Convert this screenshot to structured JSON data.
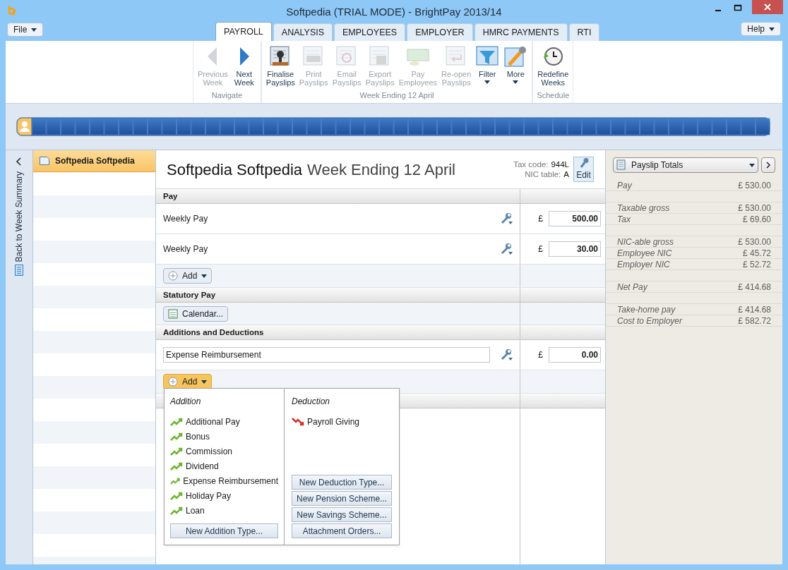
{
  "window": {
    "title": "Softpedia (TRIAL MODE) - BrightPay 2013/14"
  },
  "file_menu": "File",
  "help_menu": "Help",
  "tabs": [
    {
      "label": "PAYROLL",
      "selected": true
    },
    {
      "label": "ANALYSIS",
      "selected": false
    },
    {
      "label": "EMPLOYEES",
      "selected": false
    },
    {
      "label": "EMPLOYER",
      "selected": false
    },
    {
      "label": "HMRC PAYMENTS",
      "selected": false
    },
    {
      "label": "RTI",
      "selected": false
    }
  ],
  "ribbon_groups": [
    {
      "label": "Navigate",
      "buttons": [
        {
          "kind": "prev",
          "lines": [
            "Previous",
            "Week"
          ],
          "disabled": true,
          "dropdown": false
        },
        {
          "kind": "next",
          "lines": [
            "Next",
            "Week"
          ],
          "disabled": false,
          "dropdown": false
        }
      ]
    },
    {
      "label": "Week Ending 12 April",
      "buttons": [
        {
          "kind": "finalise",
          "lines": [
            "Finalise",
            "Payslips"
          ],
          "disabled": false,
          "dropdown": false
        },
        {
          "kind": "print",
          "lines": [
            "Print",
            "Payslips"
          ],
          "disabled": true,
          "dropdown": false
        },
        {
          "kind": "email",
          "lines": [
            "Email",
            "Payslips"
          ],
          "disabled": true,
          "dropdown": false
        },
        {
          "kind": "export",
          "lines": [
            "Export",
            "Payslips"
          ],
          "disabled": true,
          "dropdown": false
        },
        {
          "kind": "pay",
          "lines": [
            "Pay",
            "Employees"
          ],
          "disabled": true,
          "dropdown": false
        },
        {
          "kind": "reopen",
          "lines": [
            "Re-open",
            "Payslips"
          ],
          "disabled": true,
          "dropdown": false
        },
        {
          "kind": "filter",
          "lines": [
            "Filter"
          ],
          "disabled": false,
          "dropdown": true
        },
        {
          "kind": "more",
          "lines": [
            "More"
          ],
          "disabled": false,
          "dropdown": true
        }
      ]
    },
    {
      "label": "Schedule",
      "buttons": [
        {
          "kind": "redefine",
          "lines": [
            "Redefine",
            "Weeks"
          ],
          "disabled": false,
          "dropdown": false
        }
      ]
    }
  ],
  "side_tab": {
    "label": "Back to Week Summary"
  },
  "employees": [
    {
      "name": "Softpedia Softpedia",
      "selected": true
    }
  ],
  "payslip": {
    "employee": "Softpedia Softpedia",
    "period": "Week Ending 12 April",
    "tax_code_label": "Tax code:",
    "tax_code": "944L",
    "nic_label": "NIC table:",
    "nic_table": "A",
    "edit_button": "Edit",
    "sections": [
      {
        "title": "Pay",
        "rows": [
          {
            "kind": "text",
            "label": "Weekly Pay",
            "currency": "£",
            "amount": "500.00"
          },
          {
            "kind": "text",
            "label": "Weekly Pay",
            "currency": "£",
            "amount": "30.00"
          }
        ],
        "action": {
          "kind": "add",
          "label": "Add",
          "open": false
        }
      },
      {
        "title": "Statutory Pay",
        "action": {
          "kind": "calendar",
          "label": "Calendar...",
          "open": false
        }
      },
      {
        "title": "Additions and Deductions",
        "rows": [
          {
            "kind": "field",
            "label": "Expense Reimbursement",
            "currency": "£",
            "amount": "0.00"
          }
        ],
        "action": {
          "kind": "add",
          "label": "Add",
          "open": true
        }
      }
    ]
  },
  "add_menu": {
    "columns": [
      {
        "kind": "addition",
        "title": "Addition",
        "items": [
          "Additional Pay",
          "Bonus",
          "Commission",
          "Dividend",
          "Expense Reimbursement",
          "Holiday Pay",
          "Loan"
        ],
        "buttons": [
          "New Addition Type..."
        ]
      },
      {
        "kind": "deduction",
        "title": "Deduction",
        "items": [
          "Payroll Giving"
        ],
        "buttons": [
          "New Deduction Type...",
          "New Pension Scheme...",
          "New Savings Scheme...",
          "Attachment Orders..."
        ]
      }
    ]
  },
  "totals": {
    "selector": "Payslip Totals",
    "groups": [
      {
        "rows": [
          {
            "label": "Pay",
            "value": "£ 530.00"
          }
        ]
      },
      {
        "rows": [
          {
            "label": "Taxable gross",
            "value": "£ 530.00"
          },
          {
            "label": "Tax",
            "value": "£ 69.60"
          }
        ]
      },
      {
        "rows": [
          {
            "label": "NIC-able gross",
            "value": "£ 530.00"
          },
          {
            "label": "Employee NIC",
            "value": "£ 45.72"
          },
          {
            "label": "Employer NIC",
            "value": "£ 52.72"
          }
        ]
      },
      {
        "rows": [
          {
            "label": "Net Pay",
            "value": "£ 414.68"
          }
        ]
      },
      {
        "rows": [
          {
            "label": "Take-home pay",
            "value": "£ 414.68"
          },
          {
            "label": "Cost to Employer",
            "value": "£ 582.72"
          }
        ]
      }
    ]
  }
}
